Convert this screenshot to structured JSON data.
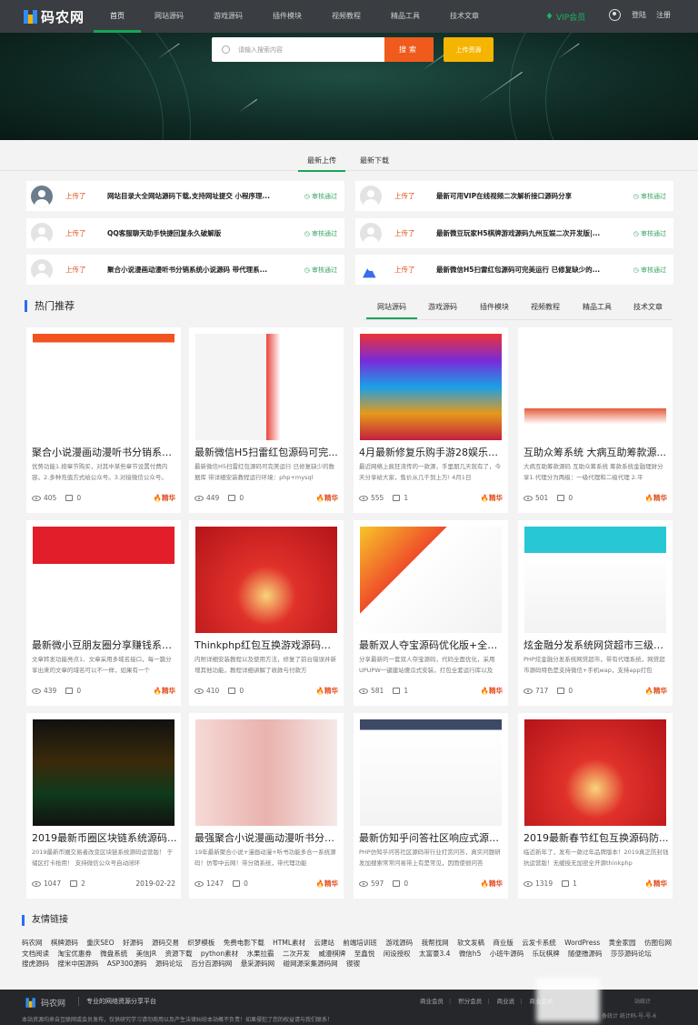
{
  "nav": {
    "logo": "码农网",
    "items": [
      "首页",
      "网站源码",
      "游戏源码",
      "插件模块",
      "视频教程",
      "精品工具",
      "技术文章"
    ],
    "vip": "VIP会员",
    "login": "登陆",
    "register": "注册"
  },
  "search": {
    "placeholder": "请输入搜索内容",
    "button": "搜索",
    "upload": "上传资源"
  },
  "upload_tabs": [
    "最新上传",
    "最新下载"
  ],
  "uploads": [
    {
      "status": "上传了",
      "title": "网站目录大全网站源码下载,支持网址提交 小程序理...",
      "check": "审核通过"
    },
    {
      "status": "上传了",
      "title": "最新可用VIP在线视频二次解析接口源码分享",
      "check": "审核通过"
    },
    {
      "status": "上传了",
      "title": "QQ客服聊天助手快捷回复永久破解版",
      "check": "审核通过"
    },
    {
      "status": "上传了",
      "title": "最新微豆玩家H5棋牌游戏源码九州互娱二次开发版|...",
      "check": "审核通过"
    },
    {
      "status": "上传了",
      "title": "聚合小说漫画动漫听书分销系统小说源码 带代理系...",
      "check": "审核通过"
    },
    {
      "status": "上传了",
      "title": "最新微信H5扫雷红包源码可完美运行 已修复缺少的...",
      "check": "审核通过"
    }
  ],
  "hot": {
    "title": "热门推荐",
    "tabs": [
      "网站源码",
      "游戏源码",
      "插件模块",
      "视频教程",
      "精品工具",
      "技术文章"
    ]
  },
  "cards": [
    {
      "title": "聚合小说漫画动漫听书分销系统...",
      "desc": "优势功能1.按章节购买，对其中某些章节设置付费内容。2.多种充值方式给公众号。3.对接微信公众号。",
      "views": "405",
      "comments": "0",
      "tag": "精华"
    },
    {
      "title": "最新微信H5扫雷红包源码可完...",
      "desc": "最新微信H5扫雷红包源码可完美运行 已修复缺少的数据库 带详细安装教程运行环境：php+mysql",
      "views": "449",
      "comments": "0",
      "tag": "精华"
    },
    {
      "title": "4月最新修复乐购手游28娱乐源...",
      "desc": "最近网络上疯狂流传的一款源，手里朋几天就有了，今天分享给大家，售价从几千到上万! 4月1日",
      "views": "555",
      "comments": "1",
      "tag": "精华"
    },
    {
      "title": "互助众筹系统 大病互助筹款源...",
      "desc": "大病互助筹款源码 互助众筹系统 筹款系统金融理财分享1.代理分为两级：一级代理和二级代理 2.平",
      "views": "501",
      "comments": "0",
      "tag": "精华"
    },
    {
      "title": "最新微小豆朋友圈分享赚钱系统...",
      "desc": "文章转发功能亮点1、文章采用多域名接口，每一篇分享出来的文章的域名可以不一样，如果有一个",
      "views": "439",
      "comments": "0",
      "tag": "精华"
    },
    {
      "title": "Thinkphp红包互换游戏源码免...",
      "desc": "内附详细安装教程以及使用方法，修复了前台错误并新增其他功能，教程详细讲解了收款与付款方",
      "views": "410",
      "comments": "0",
      "tag": "精华"
    },
    {
      "title": "最新双人夺宝源码优化版+全套...",
      "desc": "分享最新的一套双人夺宝源码，代码全面优化，采用UPUPW一键建站傻瓜式安装，打包全套运行库以及",
      "views": "581",
      "comments": "1",
      "tag": "精华"
    },
    {
      "title": "炫金融分发系统网贷超市三级分...",
      "desc": "PHP炫金融分发系统网贷超市，带有代理系统，网贷超市源码特色是支持微信+手机wap，支持app打包",
      "views": "717",
      "comments": "0",
      "tag": "精华"
    },
    {
      "title": "2019最新币圈区块链系统源码...",
      "desc": "2019最新币圈交易者改变区块链系统源码运营版！ 于储区打卡抢用！ 支持微信公众号自动闭环",
      "views": "1047",
      "comments": "2",
      "tag": "",
      "date": "2019-02-22"
    },
    {
      "title": "最强聚合小说漫画动漫听书分销...",
      "desc": "19年最新聚合小说+漫画动漫+听书功能多合一系统源码！仿零中云网！带分销系统，带代理功能",
      "views": "1247",
      "comments": "0",
      "tag": "精华"
    },
    {
      "title": "最新仿知乎问答社区响应式源码...",
      "desc": "PHP仿知乎问答社区源码带行业打赏问答，真实问题研发加搜索常常问易带上有是常见，因而使很问答",
      "views": "597",
      "comments": "0",
      "tag": "精华"
    },
    {
      "title": "2019最新春节红包互换源码防...",
      "desc": "临近新年了，发布一款过年品牌版本！2019真正防封钱抗运营版！无缓授无加密全开源thinkphp",
      "views": "1319",
      "comments": "1",
      "tag": "精华"
    }
  ],
  "friend_links": {
    "title": "友情链接",
    "items": [
      "码农网",
      "棋牌源码",
      "重庆SEO",
      "好源码",
      "源码交易",
      "织梦模板",
      "免费电影下载",
      "HTML素材",
      "云建站",
      "前端培训班",
      "游戏源码",
      "我帮找网",
      "软文发稿",
      "商业版",
      "云发卡系统",
      "WordPress",
      "黄金家园",
      "仿图包网",
      "文档阅读",
      "淘宝优惠券",
      "微盘系统",
      "美信JR",
      "资源下载",
      "python素材",
      "水果拉霸",
      "二次开发",
      "威漫棋牌",
      "至鑫悦",
      "闲设授权",
      "太富豪3.4",
      "微信h5",
      "小班牛源码",
      "乐玩棋牌",
      "随便撸源码",
      "莎莎源码论坛",
      "搜虎源码",
      "搜米中国源码",
      "ASP300源码",
      "源码论坛",
      "百分百源码网",
      "悬采源码网",
      "碰网源采集源码网",
      "锲锲"
    ]
  },
  "footer": {
    "logo": "码农网",
    "slogan": "专业的网络资源分享平台",
    "copyright": "本站资源均来自互联网或会员发布，仅供研究学习请勿商用以及产生法律纠纷本站概不负责！如果侵犯了您的权益请与我们联系！",
    "links": [
      "商业会员",
      "积分会员",
      "商业说",
      "商业会员"
    ],
    "right1": "站统计",
    "right2": "备统计 统计码-号-号-6"
  },
  "colors": {
    "accent": "#18a558",
    "orange": "#f05a1d",
    "yellow": "#f5b400",
    "nav": "#3a3d41"
  }
}
